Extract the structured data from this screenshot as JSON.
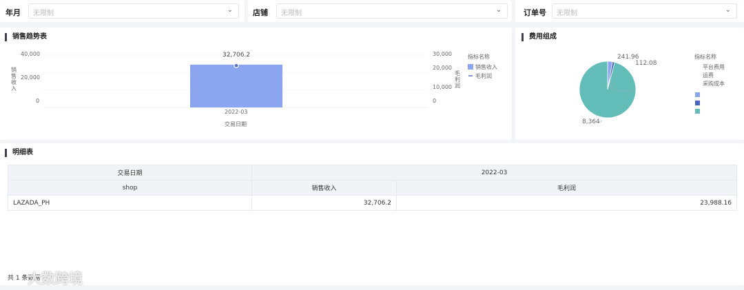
{
  "filters": [
    {
      "label": "年月",
      "placeholder": "无限制"
    },
    {
      "label": "店铺",
      "placeholder": "无限制"
    },
    {
      "label": "订单号",
      "placeholder": "无限制"
    }
  ],
  "sales_trend": {
    "title": "销售趋势表",
    "chart_data": {
      "type": "bar",
      "categories": [
        "2022-03"
      ],
      "series": [
        {
          "name": "销售收入",
          "type": "bar",
          "axis": "left",
          "values": [
            32706.2
          ],
          "color": "#8ba6ee"
        },
        {
          "name": "毛利润",
          "type": "line",
          "axis": "right",
          "values": [
            23988.16
          ],
          "color": "#5470c6"
        }
      ],
      "data_labels": [
        "32,706.2"
      ],
      "xlabel": "交易日期",
      "ylabel": "销售收入",
      "y2label": "毛利润",
      "ylim": [
        0,
        40000
      ],
      "y2lim": [
        0,
        30000
      ],
      "yticks": [
        "40,000",
        "20,000",
        "0"
      ],
      "y2ticks": [
        "30,000",
        "20,000",
        "10,000",
        "0"
      ],
      "legend_title": "指标名称",
      "legend": "right"
    }
  },
  "cost_composition": {
    "title": "费用组成",
    "chart_data": {
      "type": "pie",
      "labels": [
        "平台费用",
        "运费",
        "采购成本"
      ],
      "values": [
        241.96,
        112.08,
        8364
      ],
      "data_labels": [
        "241.96",
        "112.08",
        "8,364"
      ],
      "colors": [
        "#8ba6ee",
        "#4a62c0",
        "#62bdb8"
      ],
      "legend_title": "指标名称",
      "legend": "right"
    }
  },
  "detail": {
    "title": "明细表",
    "header1": [
      "交易日期",
      "2022-03"
    ],
    "header2": [
      "shop",
      "销售收入",
      "毛利润"
    ],
    "rows": [
      [
        "LAZADA_PH",
        "32,706.2",
        "23,988.16"
      ]
    ],
    "footer_prefix": "共",
    "footer_count": "1",
    "footer_suffix": "条数据"
  },
  "watermark": "大数跨境"
}
